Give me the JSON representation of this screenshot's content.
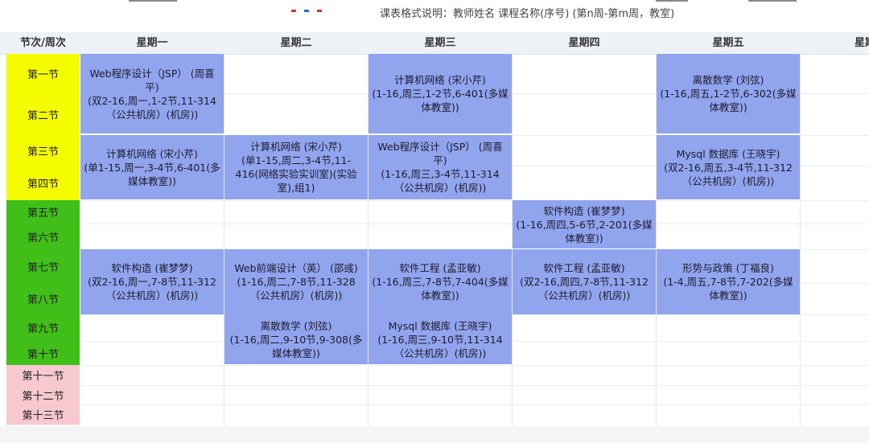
{
  "top": {
    "legend_text": "课表格式说明：教师姓名  课程名称(序号)  (第n周-第m周，教室)"
  },
  "header": {
    "corner_label": "节次/周次",
    "days": [
      "星期一",
      "星期二",
      "星期三",
      "星期四",
      "星期五",
      "星期"
    ]
  },
  "periods": [
    "第一节",
    "第二节",
    "第三节",
    "第四节",
    "第五节",
    "第六节",
    "第七节",
    "第八节",
    "第九节",
    "第十节",
    "第十一节",
    "第十二节",
    "第十三节"
  ],
  "colors": {
    "morning": "#f5fc00",
    "afternoon": "#3fbf18",
    "evening": "#f7c8d0",
    "course_bg": "#91a4ee"
  },
  "courses": [
    {
      "name": "Web程序设计（JSP） (周喜平)",
      "detail": "(双2-16,周一,1-2节,11-314（公共机房）(机房))"
    },
    {
      "name": "计算机网络 (宋小芹)",
      "detail": "(1-16,周三,1-2节,6-401(多媒体教室))"
    },
    {
      "name": "离散数学 (刘弦)",
      "detail": "(1-16,周五,1-2节,6-302(多媒体教室))"
    },
    {
      "name": "计算机网络 (宋小芹)",
      "detail": "(单1-15,周一,3-4节,6-401(多媒体教室))"
    },
    {
      "name": "计算机网络 (宋小芹)",
      "detail": "(单1-15,周二,3-4节,11-416(网络实验实训室)(实验室),组1)"
    },
    {
      "name": "Web程序设计（JSP） (周喜平)",
      "detail": "(1-16,周三,3-4节,11-314（公共机房）(机房))"
    },
    {
      "name": "Mysql 数据库 (王晓宇)",
      "detail": "(双2-16,周五,3-4节,11-312（公共机房）(机房))"
    },
    {
      "name": "软件构造 (崔梦梦)",
      "detail": "(1-16,周四,5-6节,2-201(多媒体教室))"
    },
    {
      "name": "软件构造 (崔梦梦)",
      "detail": "(双2-16,周一,7-8节,11-312（公共机房）(机房))"
    },
    {
      "name": "Web前端设计（英） (邵彧)",
      "detail": "(1-16,周二,7-8节,11-328（公共机房）(机房))"
    },
    {
      "name": "软件工程 (孟亚敏)",
      "detail": "(1-16,周三,7-8节,7-404(多媒体教室))"
    },
    {
      "name": "软件工程 (孟亚敏)",
      "detail": "(双2-16,周四,7-8节,11-312（公共机房）(机房))"
    },
    {
      "name": "形势与政策 (丁福良)",
      "detail": "(1-4,周五,7-8节,7-202(多媒体教室))"
    },
    {
      "name": "离散数学 (刘弦)",
      "detail": "(1-16,周二,9-10节,9-308(多媒体教室))"
    },
    {
      "name": "Mysql 数据库 (王晓宇)",
      "detail": "(1-16,周三,9-10节,11-314（公共机房）(机房))"
    }
  ]
}
